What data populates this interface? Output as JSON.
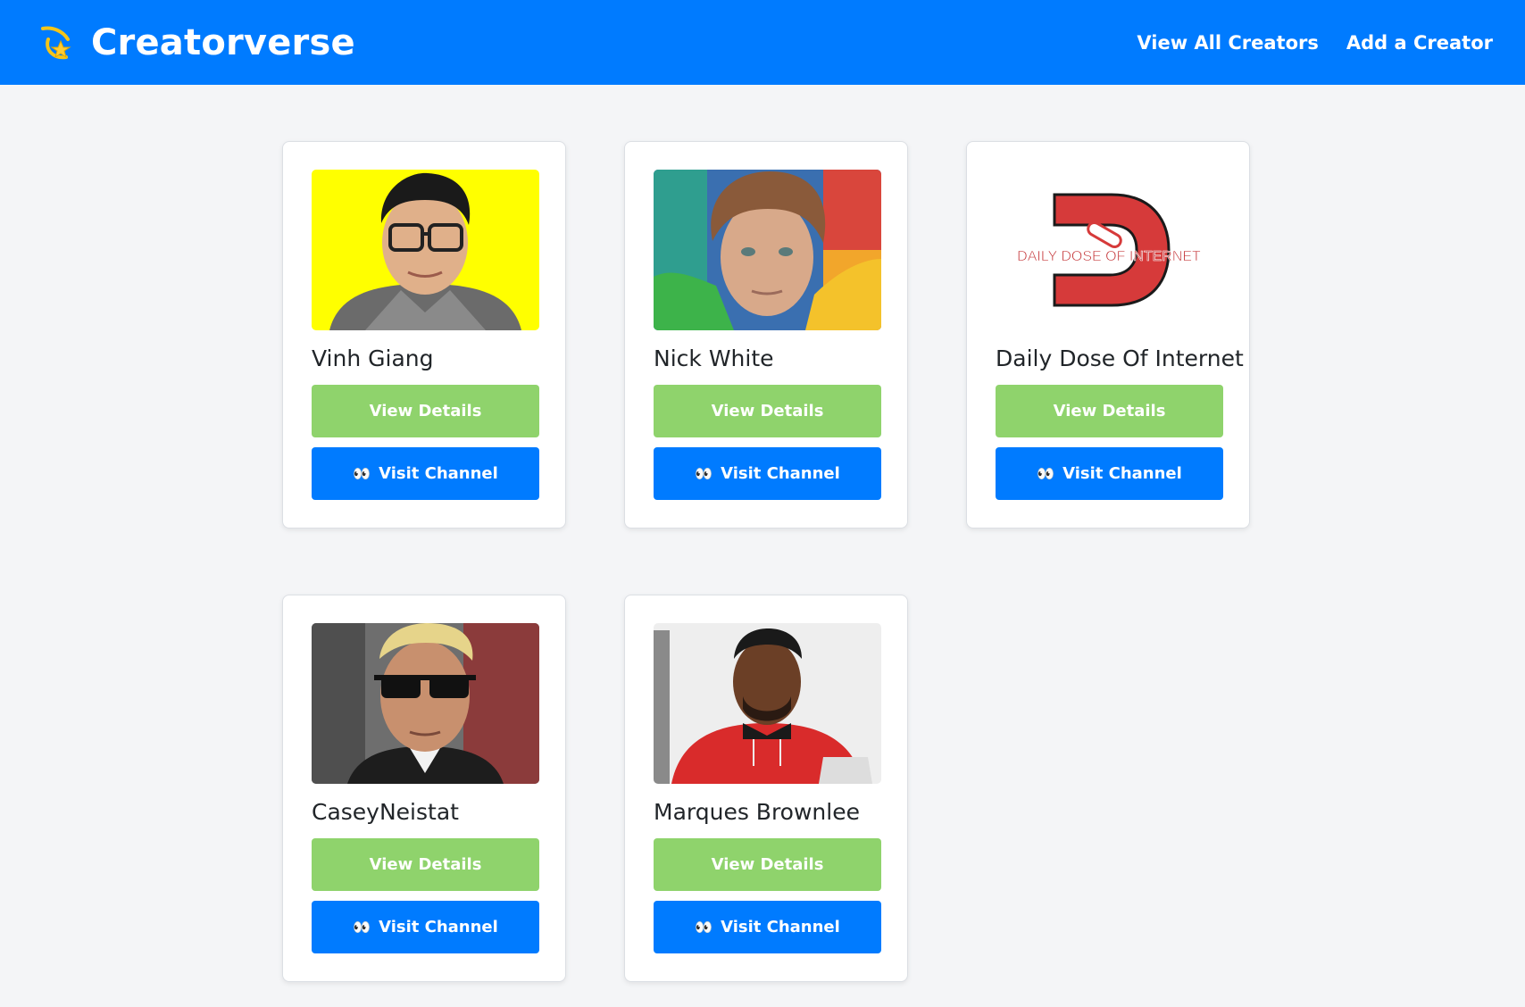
{
  "app": {
    "title": "Creatorverse",
    "logo_icon": "shooting-star-icon"
  },
  "nav": {
    "links": [
      {
        "label": "View All Creators"
      },
      {
        "label": "Add a Creator"
      }
    ]
  },
  "buttons": {
    "details_label": "View Details",
    "visit_label": "Visit Channel",
    "visit_icon": "eyes-icon",
    "visit_icon_glyph": "👀"
  },
  "colors": {
    "brand": "#007bff",
    "details_button": "#8fd36c",
    "visit_button": "#007bff",
    "background": "#f4f5f7"
  },
  "creators": [
    {
      "name": "Vinh Giang",
      "image": "portrait-glasses-yellow-background"
    },
    {
      "name": "Nick White",
      "image": "portrait-colorful-background"
    },
    {
      "name": "Daily Dose Of Internet",
      "image": "daily-dose-of-internet-logo",
      "logo_text": "DAILY DOSE OF INTERNET"
    },
    {
      "name": "CaseyNeistat",
      "image": "portrait-sunglasses-street"
    },
    {
      "name": "Marques Brownlee",
      "image": "portrait-red-hoodie"
    }
  ]
}
